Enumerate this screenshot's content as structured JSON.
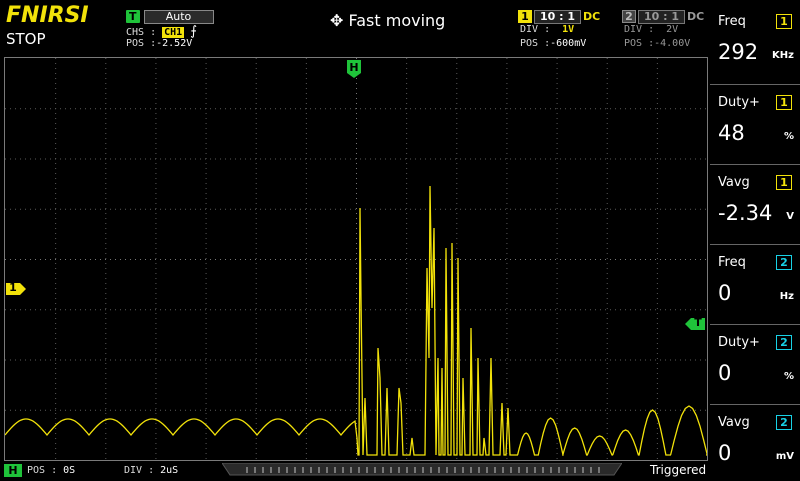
{
  "brand": "FNIRSI",
  "run_state": "STOP",
  "trigger": {
    "badge": "T",
    "mode": "Auto",
    "chs_label": "CHS :",
    "chs_value": "CH1",
    "edge_symbol": "⨍",
    "pos_label": "POS :",
    "pos_value": "-2.52V"
  },
  "status": {
    "move_icon": "✥",
    "text": "Fast moving"
  },
  "ch1": {
    "num": "1",
    "probe": "10 : 1",
    "coupling": "DC",
    "div_label": "DIV :",
    "div_value": "1V",
    "pos_label": "POS :",
    "pos_value": "-600mV",
    "color": "#f2e20a"
  },
  "ch2": {
    "num": "2",
    "probe": "10 : 1",
    "coupling": "DC",
    "div_label": "DIV :",
    "div_value": "2V",
    "pos_label": "POS :",
    "pos_value": "-4.00V",
    "color": "#18d2e6"
  },
  "markers": {
    "h_marker": "H",
    "ch1_marker": "1",
    "trig_marker": "T"
  },
  "measurements": [
    {
      "name": "Freq",
      "channel": "1",
      "value": "292",
      "unit": "KHz"
    },
    {
      "name": "Duty+",
      "channel": "1",
      "value": "48",
      "unit": "%"
    },
    {
      "name": "Vavg",
      "channel": "1",
      "value": "-2.34",
      "unit": "V"
    },
    {
      "name": "Freq",
      "channel": "2",
      "value": "0",
      "unit": "Hz"
    },
    {
      "name": "Duty+",
      "channel": "2",
      "value": "0",
      "unit": "%"
    },
    {
      "name": "Vavg",
      "channel": "2",
      "value": "0",
      "unit": "mV"
    }
  ],
  "bottom": {
    "h_badge": "H",
    "pos_label": "POS : ",
    "pos_value": "0S",
    "div_label": "DIV : ",
    "div_value": "2uS",
    "trigger_state": "Triggered"
  },
  "colors": {
    "ch1": "#f2e20a",
    "ch2": "#18d2e6",
    "trigger": "#1fc33a",
    "grid": "#5a5a5a"
  }
}
